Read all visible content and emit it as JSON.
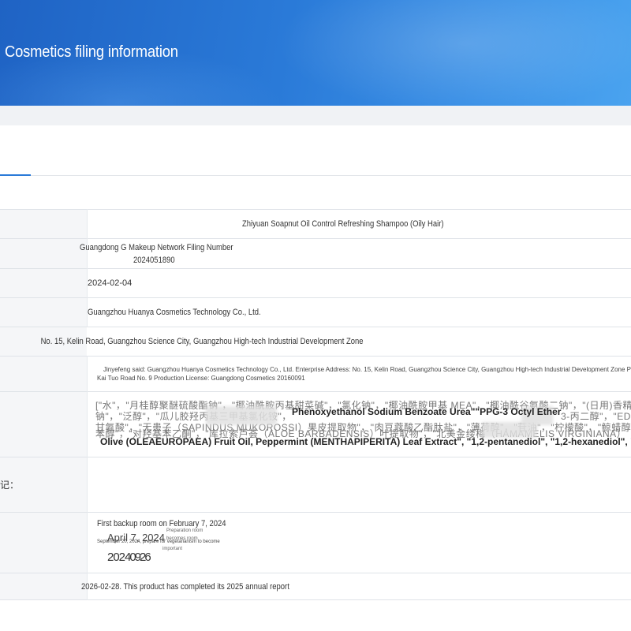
{
  "header": {
    "title": "Cosmetics filing information"
  },
  "rows": {
    "product_name": "Zhiyuan Soapnut Oil Control Refreshing Shampoo (Oily Hair)",
    "filing_number_line1": "Guangdong G Makeup Network Filing Number",
    "filing_number_line2": "2024051890",
    "filing_date": "2024-02-04",
    "filer": "Guangzhou Huanya Cosmetics Technology Co., Ltd.",
    "address": "No. 15, Kelin Road, Guangzhou Science City, Guangzhou High-tech Industrial Development Zone",
    "producer_line1": "Jinyefeng said: Guangzhou Huanya Cosmetics Technology Co., Ltd. Enterprise Address: No. 15, Kelin Road, Guangzhou Science City, Guangzhou High-tech Industrial Development Zone Production Address: Guangzhou",
    "producer_line2": "Kai Tuo Road No. 9 Production License: Guangdong Cosmetics 20160091",
    "ingredients_cn_line1": "[\"水\"，\"月桂醇聚醚硫酸酯钠\"，\"椰油酰胺丙基甜菜碱\"，\"氯化钠\"，\"椰油酰胺甲基 MEA\"，\"椰油酰谷氨酸二钠\"，\"(日用)香精\"，",
    "ingredients_cn_line2": "钠\"，\"泛醇\"，\"瓜儿胶羟丙基三甲基氯化铵\"，",
    "ingredients_cn_line2b": "3-丙二醇\"，\"EDTA 二钠\"，",
    "ingredients_cn_line3": "甘氨酸\"，\"无患子（SAPINDUS MUKOROSSI）果皮提取物\"，\"肉豆蔻酸乙酯肽盐\"，\"薄荷醇\"，\"苷油\"，\"柠檬酸\"，\"鲸蜡醇\"",
    "ingredients_cn_line4": "苯醇\"，\"对羟基苯乙酮\"，\"库拉索芦荟（ALOE BARBADENSIS）叶提取物\"，\"北美金缕梅（HAMAMELIS VIRGINIANA）",
    "ingredients_en_line1": "Phenoxyethanol Sodium Benzoate Urea\"\"PPG-3 Octyl Ether",
    "ingredients_en_line2": "Olive (OLEAEUROPAEA) Fruit Oil, Peppermint (MENTHAPIPERITA) Leaf Extract\",   \"1,2-pentanediol\", \"1,2-hexanediol\", \"octanediol\",",
    "notes_label_fragment": "记：",
    "record_line1": "First backup room on February 7, 2024",
    "record_line2": "April 7, 2024",
    "record_tiny1": "Preparation room",
    "record_tiny2": "becomes room",
    "record_tiny3": "September 20, 2024, prepare for vegetarianism to become",
    "record_tiny4": "important",
    "record_line3": "2024\u00020\u00029\u00022\u00026\u0002\u0002\u0002\u0002\u0002\u0002",
    "annual_report": "2026-02-28. This product has completed its 2025 annual report"
  }
}
